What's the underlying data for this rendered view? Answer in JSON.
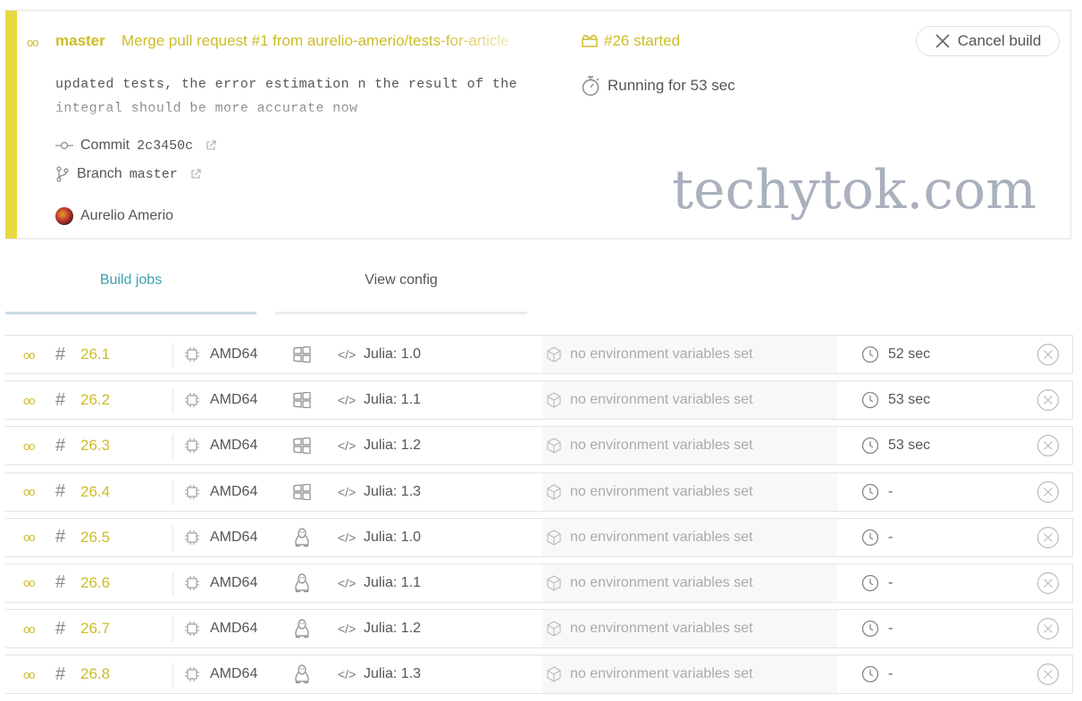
{
  "colors": {
    "accent_yellow": "#cdbc26",
    "stripe_yellow": "#e8d93f",
    "tab_active": "#3e9fb0"
  },
  "build": {
    "status_icon": "running-dots-icon",
    "status_dots": "oo",
    "branch": "master",
    "message": "Merge pull request #1 from aurelio-amerio/tests-for-article",
    "description": "updated tests, the error estimation n the result of the integral should be more accurate now",
    "commit_label": "Commit",
    "commit_sha": "2c3450c",
    "branch_label": "Branch",
    "branch_name": "master",
    "author": "Aurelio Amerio",
    "number": "#26 started",
    "duration": "Running for 53 sec",
    "cancel_label": "Cancel build"
  },
  "watermark": "techytok.com",
  "tabs": {
    "build_jobs": "Build jobs",
    "view_config": "View config"
  },
  "jobs": [
    {
      "number": "26.1",
      "arch": "AMD64",
      "os": "windows-icon",
      "lang": "Julia: 1.0",
      "env": "no environment variables set",
      "duration": "52 sec"
    },
    {
      "number": "26.2",
      "arch": "AMD64",
      "os": "windows-icon",
      "lang": "Julia: 1.1",
      "env": "no environment variables set",
      "duration": "53 sec"
    },
    {
      "number": "26.3",
      "arch": "AMD64",
      "os": "windows-icon",
      "lang": "Julia: 1.2",
      "env": "no environment variables set",
      "duration": "53 sec"
    },
    {
      "number": "26.4",
      "arch": "AMD64",
      "os": "windows-icon",
      "lang": "Julia: 1.3",
      "env": "no environment variables set",
      "duration": "-"
    },
    {
      "number": "26.5",
      "arch": "AMD64",
      "os": "linux-icon",
      "lang": "Julia: 1.0",
      "env": "no environment variables set",
      "duration": "-"
    },
    {
      "number": "26.6",
      "arch": "AMD64",
      "os": "linux-icon",
      "lang": "Julia: 1.1",
      "env": "no environment variables set",
      "duration": "-"
    },
    {
      "number": "26.7",
      "arch": "AMD64",
      "os": "linux-icon",
      "lang": "Julia: 1.2",
      "env": "no environment variables set",
      "duration": "-"
    },
    {
      "number": "26.8",
      "arch": "AMD64",
      "os": "linux-icon",
      "lang": "Julia: 1.3",
      "env": "no environment variables set",
      "duration": "-"
    }
  ]
}
